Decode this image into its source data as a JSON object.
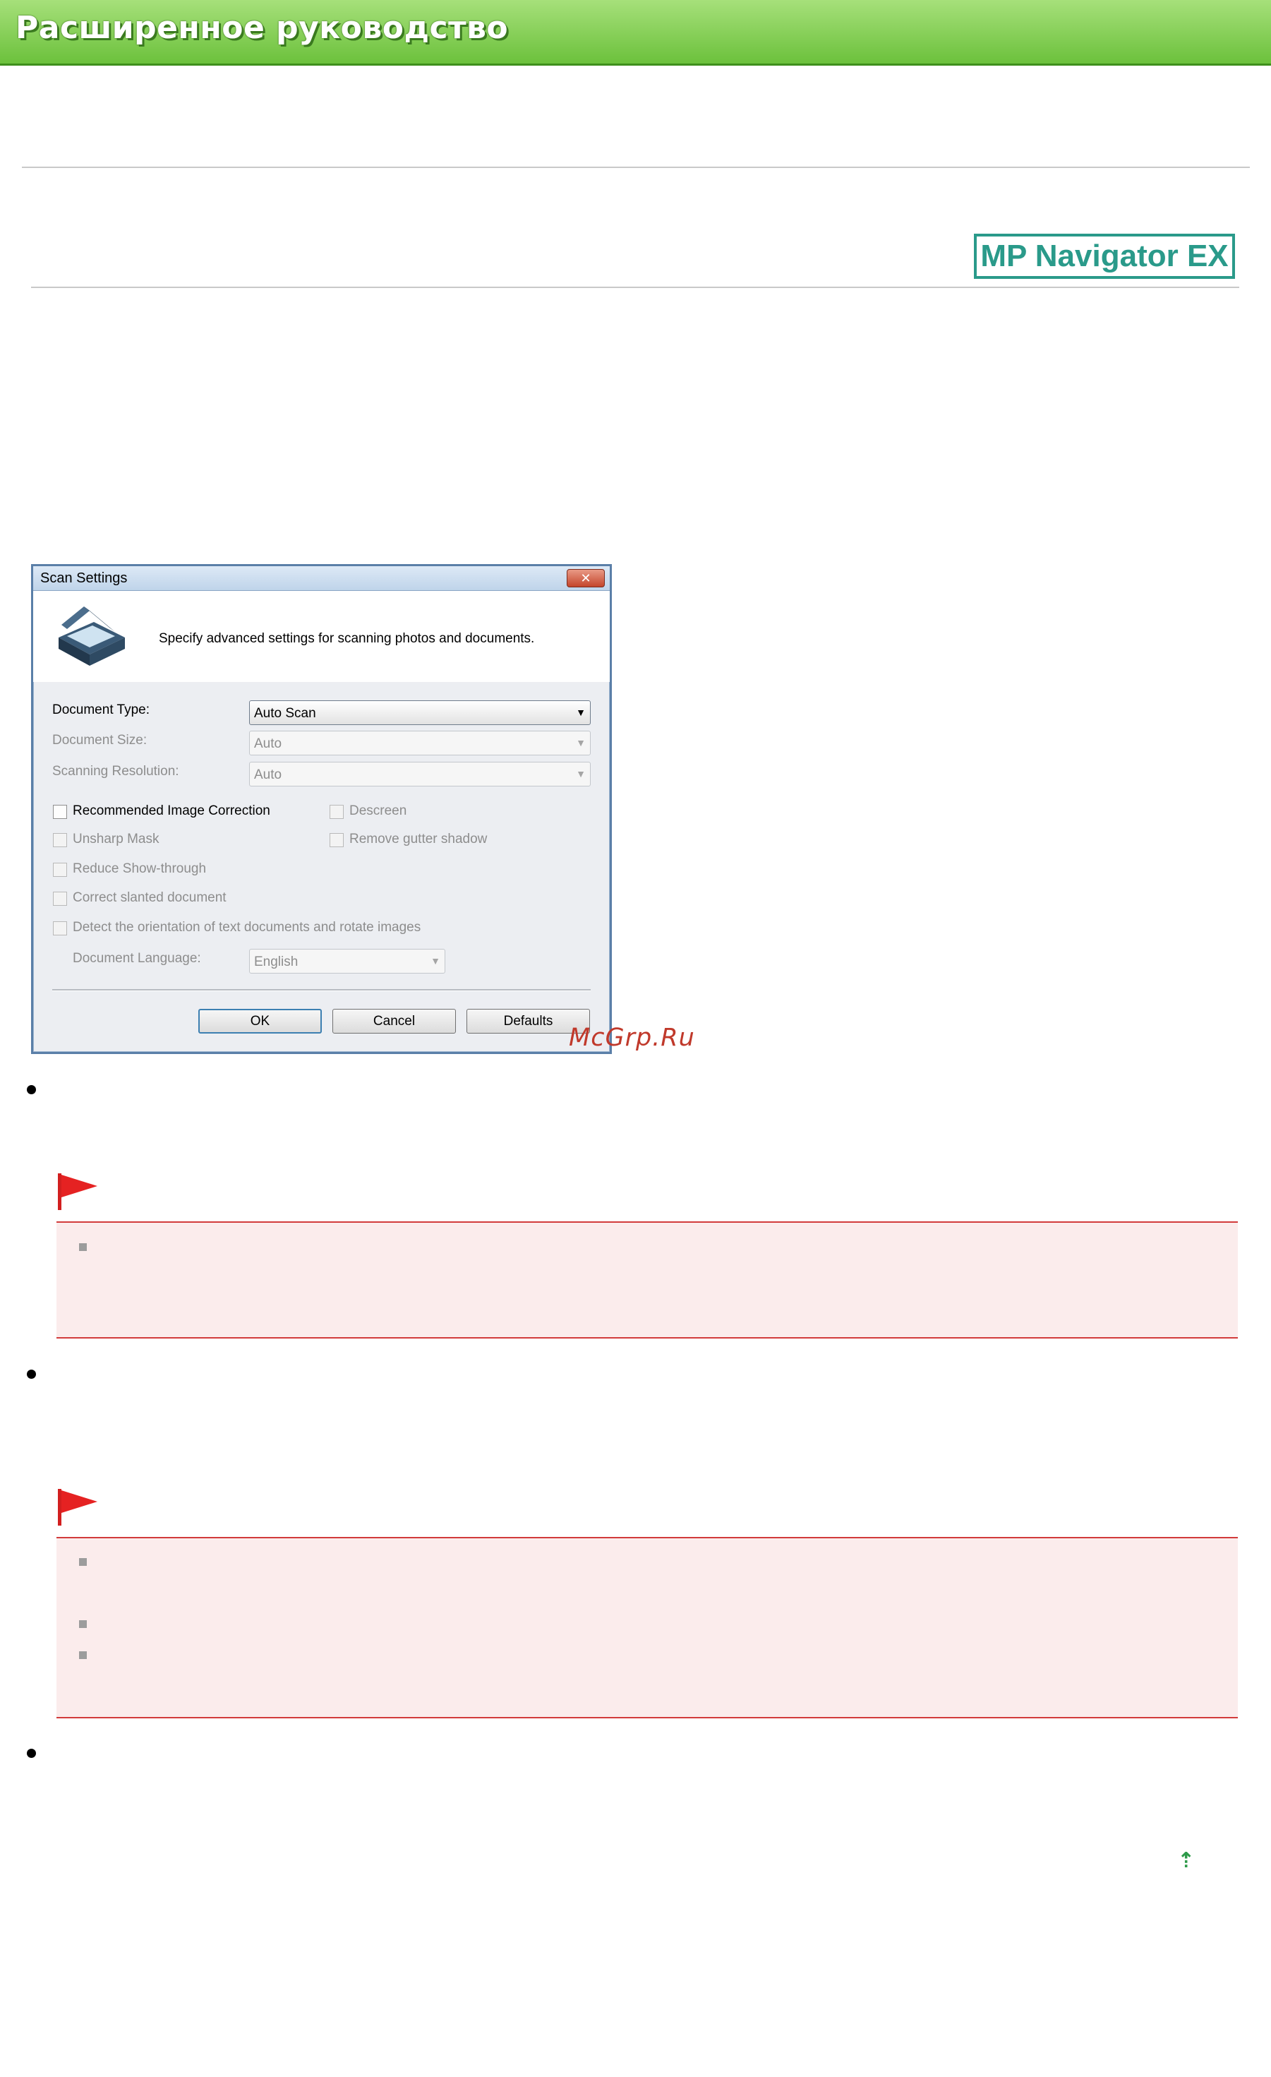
{
  "banner": {
    "title": "Расширенное руководство"
  },
  "product_logo": {
    "text": "MP Navigator EX"
  },
  "dialog": {
    "title": "Scan Settings",
    "close_label": "✕",
    "intro": "Specify advanced settings for scanning photos and documents.",
    "fields": {
      "document_type": {
        "label": "Document Type:",
        "value": "Auto Scan"
      },
      "document_size": {
        "label": "Document Size:",
        "value": "Auto"
      },
      "scanning_resolution": {
        "label": "Scanning Resolution:",
        "value": "Auto"
      },
      "document_language": {
        "label": "Document Language:",
        "value": "English"
      }
    },
    "checkboxes": {
      "recommended_image_correction": "Recommended Image Correction",
      "descreen": "Descreen",
      "unsharp_mask": "Unsharp Mask",
      "remove_gutter_shadow": "Remove gutter shadow",
      "reduce_show_through": "Reduce Show-through",
      "correct_slanted_document": "Correct slanted document",
      "detect_orientation": "Detect the orientation of text documents and rotate images"
    },
    "buttons": {
      "ok": "OK",
      "cancel": "Cancel",
      "defaults": "Defaults"
    }
  },
  "watermark": "McGrp.Ru",
  "colors": {
    "banner_green": "#6cc13c",
    "note_red": "#d23b3b",
    "note_bg": "#fbecec",
    "logo_teal": "#2a9a8a"
  },
  "icons": {
    "top_link": "up-arrow-icon",
    "important": "red-flag-icon"
  },
  "top_link_glyph": "⇡"
}
